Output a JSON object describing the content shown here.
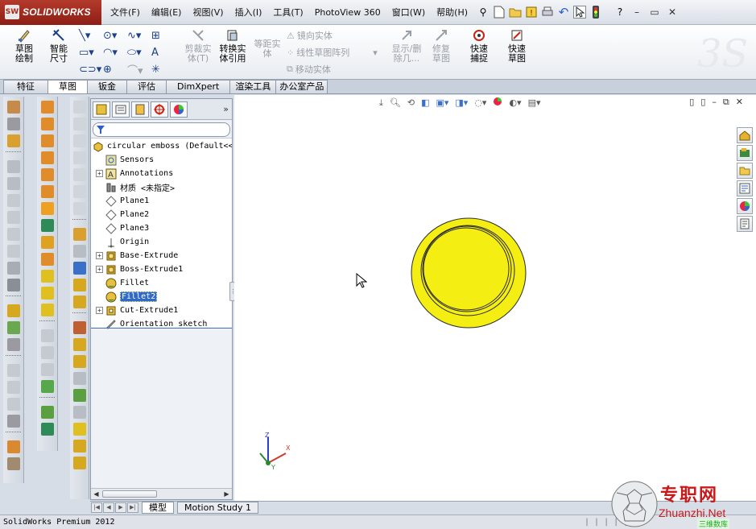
{
  "app": {
    "brand": "SOLIDWORKS",
    "brand_mark": "SW"
  },
  "menu": {
    "items": [
      "文件(F)",
      "编辑(E)",
      "视图(V)",
      "插入(I)",
      "工具(T)",
      "PhotoView 360",
      "窗口(W)",
      "帮助(H)"
    ]
  },
  "commands": {
    "sketch": "草图绘制",
    "smart_dimension": "智能尺寸",
    "trim": "剪裁实体(T)",
    "convert": "转换实体引用",
    "offset": "等距实体",
    "mirror": "镜向实体",
    "linear_pattern": "线性草图阵列",
    "move": "移动实体",
    "display_delete": "显示/删除几...",
    "repair": "修复草图",
    "quick_snaps": "快速捕捉",
    "rapid_sketch": "快速草图"
  },
  "tabs": [
    "特征",
    "草图",
    "钣金",
    "评估",
    "DimXpert",
    "渲染工具",
    "办公室产品"
  ],
  "active_tab": "草图",
  "featuretree": {
    "root": "circular emboss  (Default<<",
    "items": [
      {
        "label": "Sensors",
        "icon": "sensors-icon",
        "expandable": false
      },
      {
        "label": "Annotations",
        "icon": "annotations-icon",
        "expandable": true
      },
      {
        "label": "材质 <未指定>",
        "icon": "material-icon",
        "expandable": false
      },
      {
        "label": "Plane1",
        "icon": "plane-icon",
        "expandable": false
      },
      {
        "label": "Plane2",
        "icon": "plane-icon",
        "expandable": false
      },
      {
        "label": "Plane3",
        "icon": "plane-icon",
        "expandable": false
      },
      {
        "label": "Origin",
        "icon": "origin-icon",
        "expandable": false
      },
      {
        "label": "Base-Extrude",
        "icon": "extrude-icon",
        "expandable": true
      },
      {
        "label": "Boss-Extrude1",
        "icon": "extrude-icon",
        "expandable": true
      },
      {
        "label": "Fillet",
        "icon": "fillet-icon",
        "expandable": false
      },
      {
        "label": "Fillet2",
        "icon": "fillet-icon",
        "expandable": false,
        "selected": true
      },
      {
        "label": "Cut-Extrude1",
        "icon": "cut-extrude-icon",
        "expandable": true
      },
      {
        "label": "Orientation sketch",
        "icon": "sketch-icon",
        "expandable": false
      }
    ]
  },
  "model_tabs": [
    "模型",
    "Motion Study 1"
  ],
  "active_model_tab": "模型",
  "status": "SolidWorks Premium 2012",
  "triad": {
    "x": "X",
    "y": "Y",
    "z": "Z"
  },
  "watermark": {
    "title": "专职网",
    "url": "Zhuanzhi.Net",
    "sub": "三维数库"
  },
  "colors": {
    "part_fill": "#f5ee13",
    "selection": "#3169c6",
    "brand": "#a52a1d"
  }
}
